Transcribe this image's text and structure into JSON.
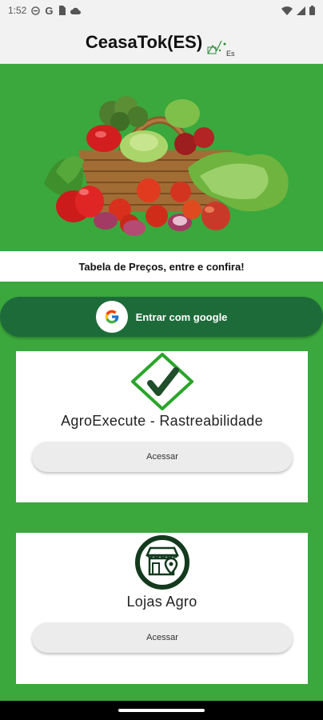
{
  "status_bar": {
    "time": "1:52"
  },
  "header": {
    "title": "CeasaTok(ES)",
    "logo_text": "Es"
  },
  "hero": {
    "tagline": "Tabela de Preços, entre e confira!"
  },
  "google": {
    "label": "Entrar com google"
  },
  "cards": [
    {
      "title": "AgroExecute - Rastreabilidade",
      "button": "Acessar",
      "icon": "check-diamond-icon"
    },
    {
      "title": "Lojas Agro",
      "button": "Acessar",
      "icon": "store-location-icon"
    }
  ],
  "colors": {
    "background": "#3aa83c",
    "google_button": "#1e6b3a",
    "card": "#ffffff",
    "accent_dark": "#1a5a2a"
  }
}
